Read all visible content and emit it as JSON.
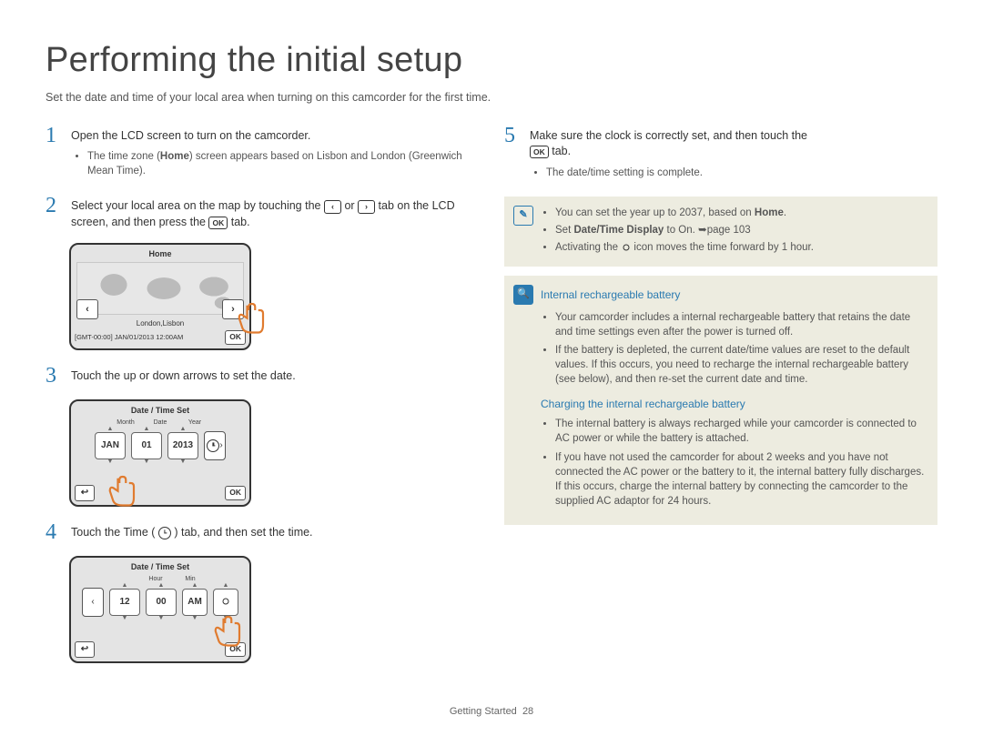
{
  "page": {
    "title": "Performing the initial setup",
    "subtitle": "Set the date and time of your local area when turning on this camcorder for the first time.",
    "footer_section": "Getting Started",
    "footer_page": "28"
  },
  "steps": {
    "s1": {
      "num": "1",
      "text_a": "Open the LCD screen to turn on the camcorder.",
      "b1_a": "The time zone (",
      "b1_b": "Home",
      "b1_c": ") screen appears based on Lisbon and London (Greenwich Mean Time)."
    },
    "s2": {
      "num": "2",
      "text_a": "Select your local area on the map by touching the ",
      "text_b": " or ",
      "text_c": " tab on the LCD screen, and then press the ",
      "text_d": " tab.",
      "icon_left": "‹",
      "icon_right": "›",
      "ok": "OK"
    },
    "s3": {
      "num": "3",
      "text": "Touch the up or down arrows to set the date."
    },
    "s4": {
      "num": "4",
      "text_a": "Touch the Time ( ",
      "text_b": " ) tab, and then set the time."
    },
    "s5": {
      "num": "5",
      "text_a": "Make sure the clock is correctly set, and then touch the ",
      "text_b": " tab.",
      "ok": "OK",
      "bullet": "The date/time setting is complete."
    }
  },
  "device_home": {
    "title": "Home",
    "location": "London,Lisbon",
    "gmt": "[GMT-00:00] JAN/01/2013 12:00AM",
    "ok": "OK",
    "left": "‹",
    "right": "›"
  },
  "device_date": {
    "title": "Date / Time Set",
    "lbl_month": "Month",
    "lbl_date": "Date",
    "lbl_year": "Year",
    "month": "JAN",
    "date": "01",
    "year": "2013",
    "ok": "OK",
    "back": "↩"
  },
  "device_time": {
    "title": "Date / Time Set",
    "lbl_hour": "Hour",
    "lbl_min": "Min",
    "hour": "12",
    "min": "00",
    "ampm": "AM",
    "ok": "OK",
    "back": "↩",
    "left": "‹"
  },
  "notes": {
    "n1_a": "You can set the year up to 2037, based on ",
    "n1_b": "Home",
    "n1_c": ".",
    "n2_a": "Set ",
    "n2_b": "Date/Time Display",
    "n2_c": " to On. ",
    "n2_d": "page 103",
    "n3_a": "Activating the ",
    "n3_b": " icon moves the time forward by 1 hour."
  },
  "info": {
    "title1": "Internal rechargeable battery",
    "b1": "Your camcorder includes a internal rechargeable battery that retains the date and time settings even after the power is turned off.",
    "b2": "If the battery is depleted, the current date/time values are reset to the default values. If this occurs, you need to recharge the internal rechargeable battery (see below), and then re-set the current date and time.",
    "title2": "Charging the internal rechargeable battery",
    "c1": "The internal battery is always recharged while your camcorder is connected to AC power or while the battery is attached.",
    "c2": "If you have not used the camcorder for about 2 weeks and you have not connected the AC power or the battery to it, the internal battery fully discharges. If this occurs, charge the internal battery by connecting the camcorder to the supplied AC adaptor for 24 hours."
  }
}
